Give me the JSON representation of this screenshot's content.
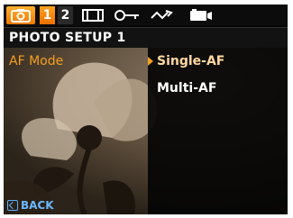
{
  "tabs": [
    {
      "id": "camera",
      "icon": "camera-icon"
    },
    {
      "id": "page1",
      "label": "1"
    },
    {
      "id": "page2",
      "label": "2"
    },
    {
      "id": "video",
      "icon": "film-icon"
    },
    {
      "id": "setup",
      "icon": "wrench-icon"
    },
    {
      "id": "return",
      "icon": "return-arrow-icon"
    },
    {
      "id": "play",
      "icon": "playback-icon"
    }
  ],
  "menu": {
    "title": "PHOTO SETUP 1",
    "setting_label": "AF Mode",
    "options": [
      {
        "label": "Single-AF",
        "selected": true
      },
      {
        "label": "Multi-AF",
        "selected": false
      }
    ]
  },
  "footer": {
    "back_label": "BACK"
  },
  "colors": {
    "accent": "#f5a020",
    "back": "#6ab8ff"
  }
}
